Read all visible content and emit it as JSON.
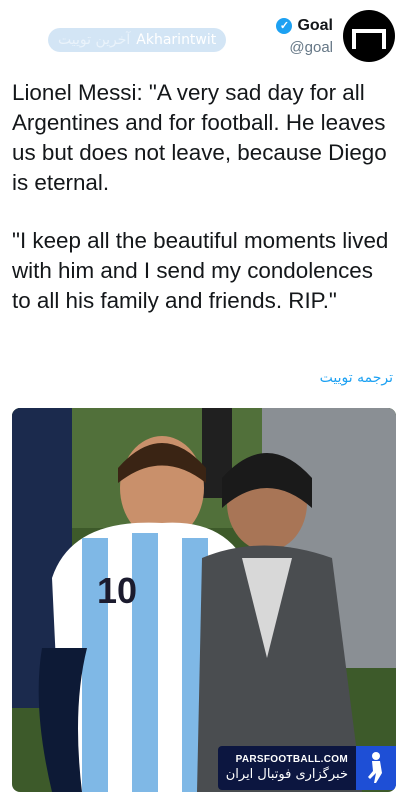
{
  "watermark": {
    "persian": "آخرین توییت",
    "latin": "Akharintwit"
  },
  "account": {
    "display_name": "Goal",
    "handle": "@goal",
    "verified": true
  },
  "tweet": {
    "paragraph1": "Lionel Messi: \"A very sad day for all Argentines and for football. He leaves us but does not leave, because Diego is eternal.",
    "paragraph2": "\"I keep all the beautiful moments lived with him and I send my condolences to all his family and friends. RIP.\""
  },
  "translate_label": "ترجمه توییت",
  "photo_badge": {
    "site": "PARSFOOTBALL.COM",
    "persian": "خبرگزاری فوتبال ایران"
  },
  "colors": {
    "accent": "#1da1f2",
    "badge_bg": "#0c1640",
    "jersey_blue": "#7fb8e6"
  }
}
